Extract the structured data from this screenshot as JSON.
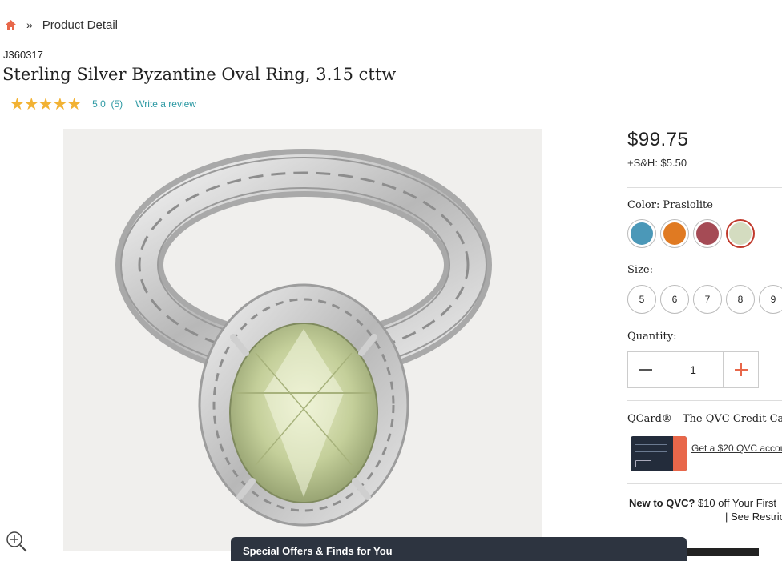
{
  "breadcrumb": {
    "home_icon": "home-icon",
    "separator": "»",
    "current": "Product Detail"
  },
  "product": {
    "item_number": "J360317",
    "title": "Sterling Silver Byzantine Oval Ring, 3.15 cttw",
    "stars": "★★★★★",
    "rating": "5.0",
    "review_count": "(5)",
    "write_review": "Write a review"
  },
  "gallery": {
    "zoom_icon": "zoom-in-icon"
  },
  "pricing": {
    "price": "$99.75",
    "shipping": "+S&H: $5.50"
  },
  "color": {
    "label": "Color:",
    "selected": "Prasiolite",
    "swatches": [
      {
        "name": "blue",
        "color": "#4b98b8"
      },
      {
        "name": "orange",
        "color": "#e07a22"
      },
      {
        "name": "red",
        "color": "#a54b55"
      },
      {
        "name": "prasiolite",
        "color": "#d4dcc0"
      }
    ],
    "selected_index": 3,
    "accent": "#c0392b"
  },
  "size": {
    "label": "Size:",
    "options": [
      "5",
      "6",
      "7",
      "8",
      "9"
    ]
  },
  "quantity": {
    "label": "Quantity:",
    "value": "1",
    "minus_icon": "minus-icon",
    "plus_icon": "plus-icon",
    "plus_color": "#e8674a"
  },
  "qcard": {
    "title": "QCard®—The QVC Credit Ca",
    "link": "Get a $20 QVC accou"
  },
  "new_to_qvc": {
    "bold": "New to QVC?",
    "text": " $10 off Your First",
    "separator": "| ",
    "restrictions": "See Restric"
  },
  "offers_bar": {
    "label": "Special Offers & Finds for You"
  },
  "colors": {
    "link": "#2e9aa4",
    "star": "#f2b233",
    "home": "#e8674a",
    "bar": "#2d3440"
  }
}
